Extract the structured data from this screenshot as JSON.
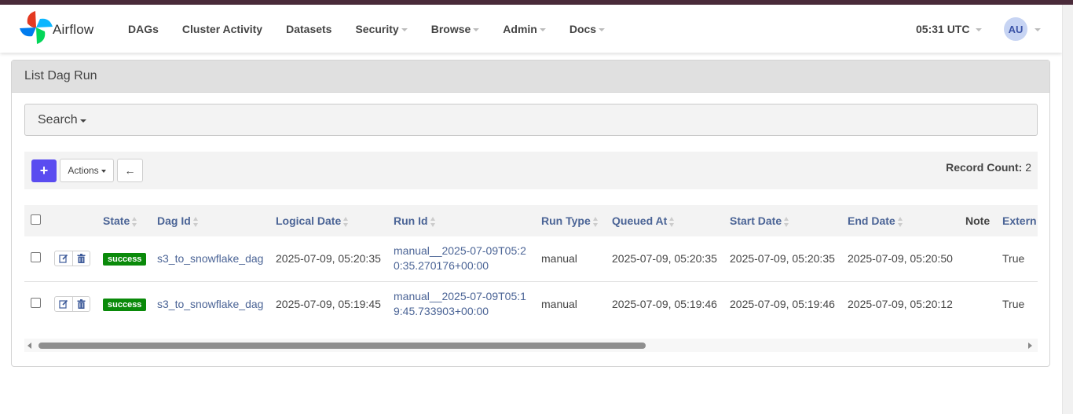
{
  "app": {
    "name": "Airflow",
    "logo_icon": "airflow-pinwheel-icon"
  },
  "nav": {
    "items": [
      {
        "label": "DAGs",
        "dropdown": false
      },
      {
        "label": "Cluster Activity",
        "dropdown": false
      },
      {
        "label": "Datasets",
        "dropdown": false
      },
      {
        "label": "Security",
        "dropdown": true
      },
      {
        "label": "Browse",
        "dropdown": true
      },
      {
        "label": "Admin",
        "dropdown": true
      },
      {
        "label": "Docs",
        "dropdown": true
      }
    ],
    "clock": "05:31 UTC",
    "avatar": "AU"
  },
  "panel": {
    "title": "List Dag Run",
    "search_label": "Search",
    "add_label": "+",
    "actions_label": "Actions",
    "back_label": "←",
    "record_count_label": "Record Count:",
    "record_count": "2"
  },
  "table": {
    "headers": {
      "state": "State",
      "dag_id": "Dag Id",
      "logical_date": "Logical Date",
      "run_id": "Run Id",
      "run_type": "Run Type",
      "queued_at": "Queued At",
      "start_date": "Start Date",
      "end_date": "End Date",
      "note": "Note",
      "external": "Extern"
    },
    "rows": [
      {
        "state": "success",
        "dag_id": "s3_to_snowflake_dag",
        "logical_date": "2025-07-09, 05:20:35",
        "run_id": "manual__2025-07-09T05:20:35.270176+00:00",
        "run_type": "manual",
        "queued_at": "2025-07-09, 05:20:35",
        "start_date": "2025-07-09, 05:20:35",
        "end_date": "2025-07-09, 05:20:50",
        "note": "",
        "external": "True"
      },
      {
        "state": "success",
        "dag_id": "s3_to_snowflake_dag",
        "logical_date": "2025-07-09, 05:19:45",
        "run_id": "manual__2025-07-09T05:19:45.733903+00:00",
        "run_type": "manual",
        "queued_at": "2025-07-09, 05:19:46",
        "start_date": "2025-07-09, 05:19:46",
        "end_date": "2025-07-09, 05:20:12",
        "note": "",
        "external": "True"
      }
    ]
  },
  "colors": {
    "primary": "#5a4cf0",
    "success": "#0a8a0a",
    "link": "#4b6496",
    "topbar": "#4a2b3a"
  }
}
